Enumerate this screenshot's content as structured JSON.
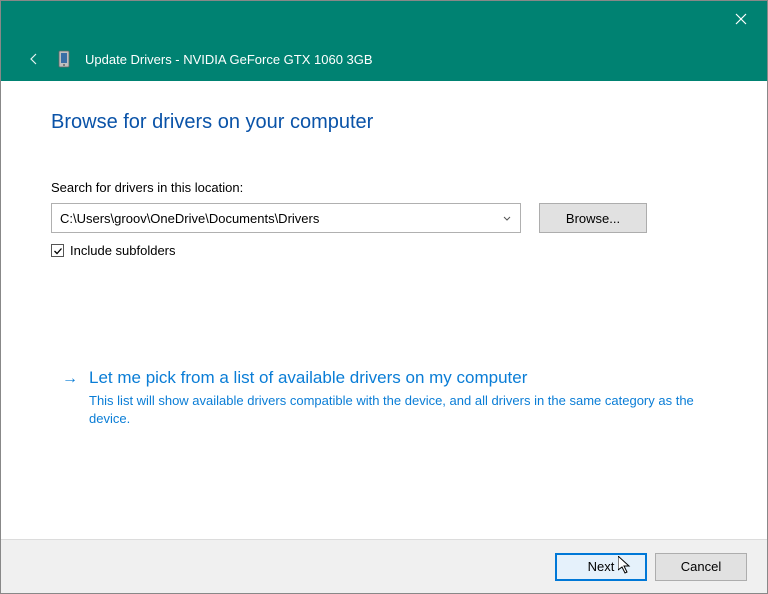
{
  "header": {
    "title": "Update Drivers - NVIDIA GeForce GTX 1060 3GB"
  },
  "page": {
    "title": "Browse for drivers on your computer",
    "search_label": "Search for drivers in this location:",
    "path_value": "C:\\Users\\groov\\OneDrive\\Documents\\Drivers",
    "browse_label": "Browse...",
    "include_subfolders_label": "Include subfolders",
    "include_subfolders_checked": true
  },
  "option": {
    "title": "Let me pick from a list of available drivers on my computer",
    "description": "This list will show available drivers compatible with the device, and all drivers in the same category as the device."
  },
  "footer": {
    "next_label": "Next",
    "cancel_label": "Cancel"
  }
}
